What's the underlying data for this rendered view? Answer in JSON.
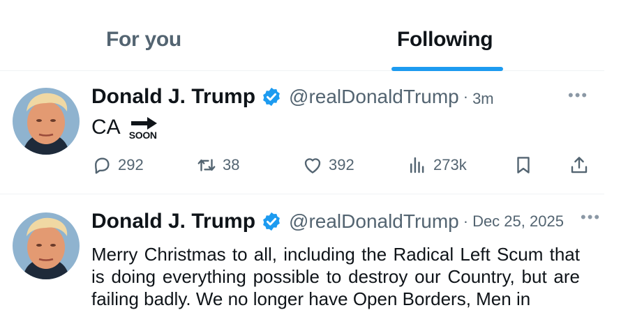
{
  "tabs": {
    "for_you": "For you",
    "following": "Following"
  },
  "tweets": [
    {
      "name": "Donald J. Trump",
      "handle": "@realDonaldTrump",
      "separator": "·",
      "time": "3m",
      "text": "CA",
      "emoji_label": "SOON",
      "replies": "292",
      "reposts": "38",
      "likes": "392",
      "views": "273k",
      "more": "•••"
    },
    {
      "name": "Donald J. Trump",
      "handle": "@realDonaldTrump",
      "separator": "·",
      "time": "Dec 25, 2025",
      "text": "Merry Christmas to all, including the Radical Left Scum that is doing everything possible to destroy our Country, but are failing badly. We no longer have Open Borders, Men in",
      "more": "•••"
    }
  ],
  "colors": {
    "accent": "#1d9bf0",
    "secondary_text": "#536471",
    "primary_text": "#0f1419"
  }
}
